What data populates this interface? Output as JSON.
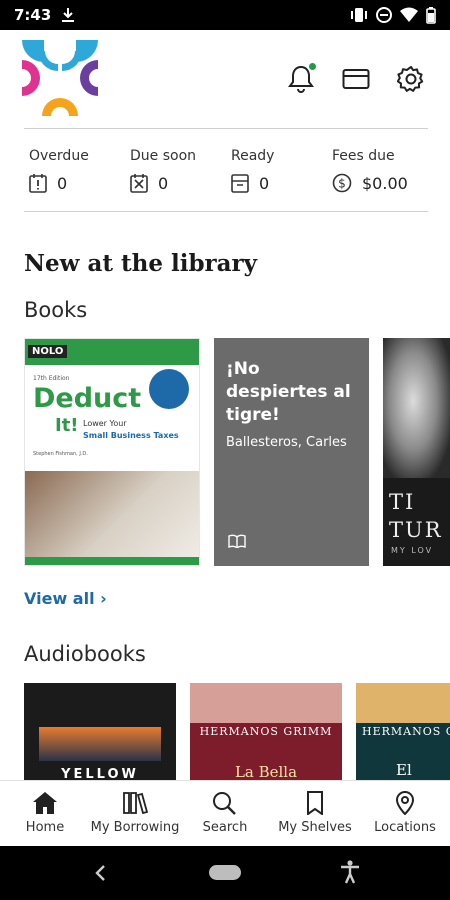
{
  "status_bar": {
    "time": "7:43"
  },
  "stats": [
    {
      "label": "Overdue",
      "value": "0",
      "icon": "alert-book-icon"
    },
    {
      "label": "Due soon",
      "value": "0",
      "icon": "hourglass-box-icon"
    },
    {
      "label": "Ready",
      "value": "0",
      "icon": "archive-box-icon"
    },
    {
      "label": "Fees due",
      "value": "$0.00",
      "icon": "dollar-circle-icon"
    }
  ],
  "section_title": "New at the library",
  "books": {
    "title": "Books",
    "items": [
      {
        "brand": "NOLO",
        "edition": "17th Edition",
        "title_line1": "Deduct",
        "title_line2": "It!",
        "subtitle1": "Lower Your",
        "subtitle2": "Small Business Taxes",
        "author": "Stephen Fishman, J.D."
      },
      {
        "title": "¡No despiertes al tigre!",
        "author": "Ballesteros, Carles"
      },
      {
        "title_partial": "TI TUR",
        "subtitle_partial": "MY LOV"
      }
    ],
    "view_all": "View all"
  },
  "audiobooks": {
    "title": "Audiobooks",
    "items": [
      {
        "title_partial": "YELLOW"
      },
      {
        "top": "HERMANOS GRIMM",
        "title_partial": "La Bella"
      },
      {
        "top": "HERMANOS G",
        "title_partial": "El"
      }
    ]
  },
  "bottom_nav": [
    {
      "label": "Home",
      "icon": "home-icon",
      "active": true
    },
    {
      "label": "My Borrowing",
      "icon": "books-icon"
    },
    {
      "label": "Search",
      "icon": "search-icon"
    },
    {
      "label": "My Shelves",
      "icon": "bookmark-icon"
    },
    {
      "label": "Locations",
      "icon": "location-pin-icon"
    }
  ]
}
